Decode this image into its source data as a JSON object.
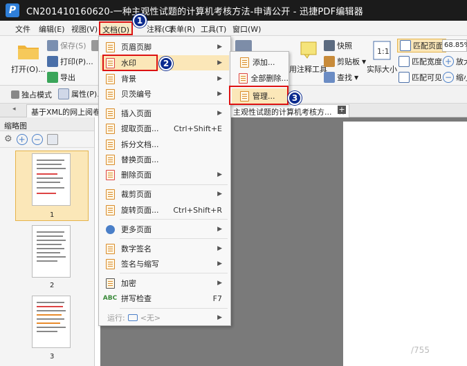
{
  "title": "CN201410160620-一种主观性试题的计算机考核方法-申请公开 - 迅捷PDF编辑器",
  "menubar": [
    "文件",
    "编辑(E)",
    "视图(V)",
    "文档(D)",
    "注释(C)",
    "表单(R)",
    "工具(T)",
    "窗口(W)"
  ],
  "ribbon": {
    "open": "打开(O)...",
    "save": "保存(S)",
    "print": "打印(P)...",
    "export": "导出",
    "snapshot": "快照",
    "clipboard": "剪贴板",
    "find": "查找",
    "annot_tool": "用注释工具",
    "actual_size": "实际大小",
    "fit_page": "匹配页面",
    "fit_width": "匹配宽度",
    "fit_visible": "匹配可见",
    "zoom": "68.85%",
    "zoom_in": "放大",
    "zoom_out": "缩小"
  },
  "quickbar": {
    "mode": "独占模式",
    "props": "属性(P)..."
  },
  "tabs": {
    "tab1": "基于XML的网上阅卷",
    "tab2": "主观性试题的计算机考核方..."
  },
  "sidebar": {
    "title": "缩略图",
    "pages": [
      "1",
      "2",
      "3"
    ]
  },
  "doc_menu": {
    "header_footer": "页眉页脚",
    "watermark": "水印",
    "background": "背景",
    "bates": "贝茨编号",
    "insert_pages": "插入页面",
    "extract_pages": "提取页面...",
    "extract_sc": "Ctrl+Shift+E",
    "split": "拆分文档...",
    "replace": "替换页面...",
    "delete": "删除页面",
    "crop": "裁剪页面",
    "rotate": "旋转页面...",
    "rotate_sc": "Ctrl+Shift+R",
    "more_pages": "更多页面",
    "digital_sig": "数字签名",
    "sign_initial": "签名与缩写",
    "encrypt": "加密",
    "spell": "拼写检查",
    "spell_sc": "F7",
    "run": "运行:",
    "run_value": "<无>"
  },
  "watermark_menu": {
    "add": "添加...",
    "remove_all": "全部删除...",
    "manage": "管理..."
  },
  "badges": [
    "1",
    "2",
    "3"
  ],
  "corner_text": "/755",
  "colors": {
    "highlight_red": "#dd1111",
    "badge_blue": "#0b2b8f",
    "titlebar": "#1b1b1b"
  }
}
